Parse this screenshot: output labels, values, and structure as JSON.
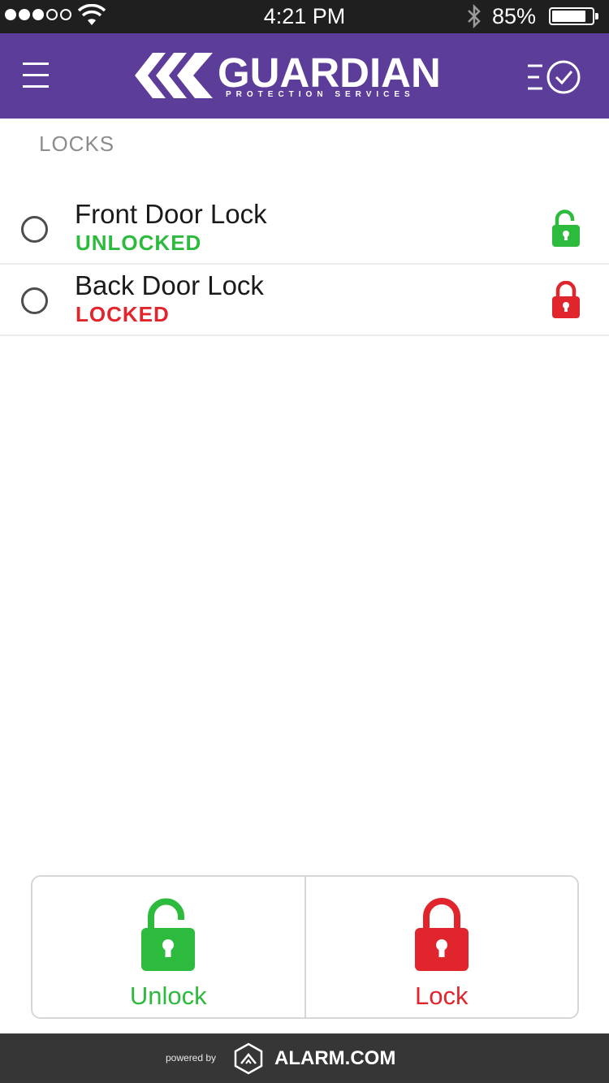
{
  "status_bar": {
    "time": "4:21 PM",
    "battery_percent": "85%",
    "battery_level": 0.85,
    "signal_bars_filled": 3,
    "signal_bars_total": 5,
    "icons": [
      "wifi-icon",
      "bluetooth-icon",
      "battery-icon"
    ]
  },
  "header": {
    "brand_name": "GUARDIAN",
    "brand_tagline": "PROTECTION SERVICES",
    "menu_icon": "hamburger-menu-icon",
    "history_icon": "history-clock-icon",
    "background_color": "#5c3d99"
  },
  "locks_section": {
    "title": "LOCKS",
    "items": [
      {
        "name": "Front Door Lock",
        "status": "UNLOCKED",
        "status_color": "#2dbb3e",
        "icon": "unlocked-padlock-icon",
        "selected": false
      },
      {
        "name": "Back Door Lock",
        "status": "LOCKED",
        "status_color": "#e0262c",
        "icon": "locked-padlock-icon",
        "selected": false
      }
    ]
  },
  "actions": {
    "unlock_label": "Unlock",
    "unlock_color": "#2dbb3e",
    "unlock_icon": "unlocked-padlock-icon",
    "lock_label": "Lock",
    "lock_color": "#e0262c",
    "lock_icon": "locked-padlock-icon"
  },
  "footer": {
    "powered_by": "powered by",
    "provider": "ALARM.COM",
    "provider_icon": "alarm-com-logo-icon"
  }
}
